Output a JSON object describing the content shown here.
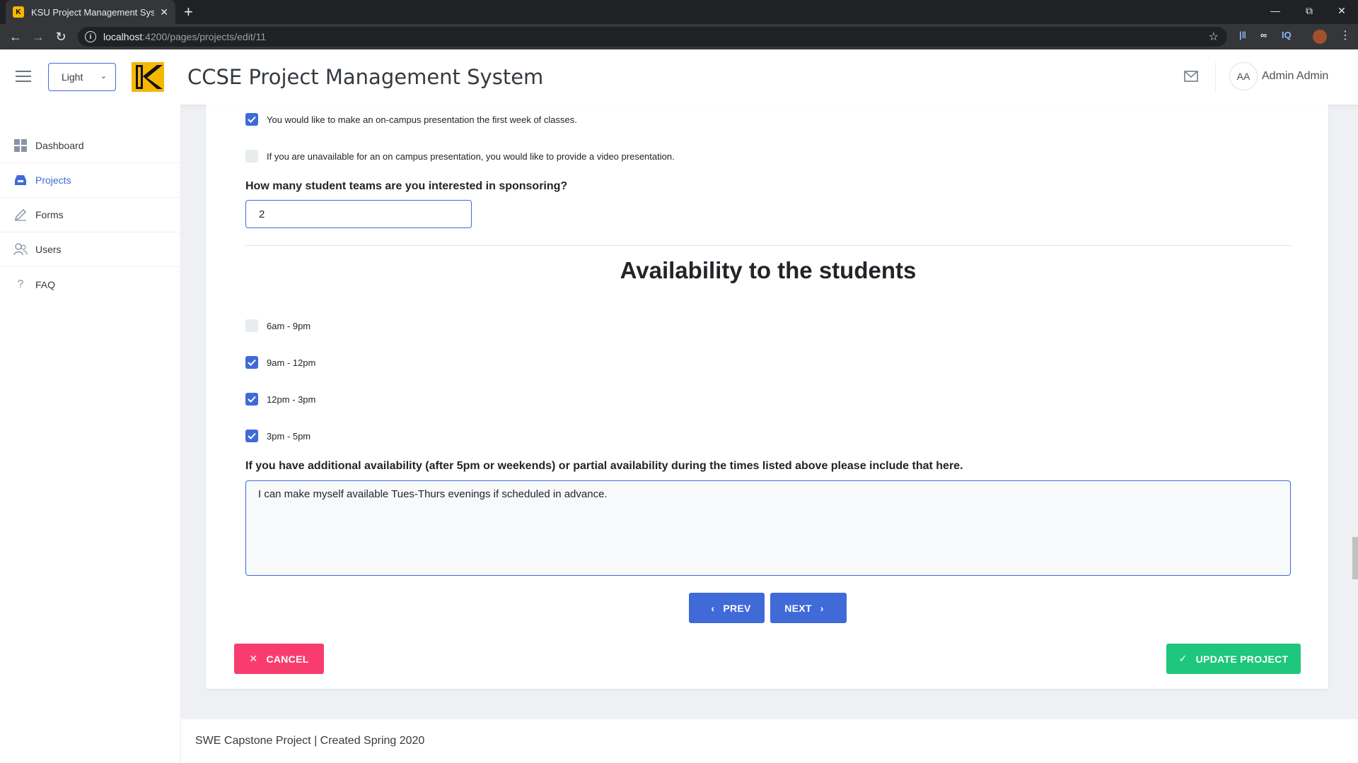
{
  "browser": {
    "tab_title": "KSU Project Management System",
    "url_host": "localhost",
    "url_path": ":4200/pages/projects/edit/11"
  },
  "header": {
    "theme_value": "Light",
    "app_title": "CCSE Project Management System",
    "avatar_initials": "AA",
    "user_name": "Admin Admin"
  },
  "sidebar": {
    "items": [
      {
        "label": "Dashboard",
        "icon": "dashboard-icon"
      },
      {
        "label": "Projects",
        "icon": "inbox-icon"
      },
      {
        "label": "Forms",
        "icon": "pencil-icon"
      },
      {
        "label": "Users",
        "icon": "users-icon"
      },
      {
        "label": "FAQ",
        "icon": "question-icon"
      }
    ]
  },
  "form": {
    "presentation_options": [
      {
        "label": "You would like to make an on-campus presentation the first week of classes.",
        "checked": true
      },
      {
        "label": "If you are unavailable for an on campus presentation, you would like to provide a video presentation.",
        "checked": false
      }
    ],
    "teams_question": "How many student teams are you interested in sponsoring?",
    "teams_value": "2",
    "availability_title": "Availability to the students",
    "availability_options": [
      {
        "label": "6am - 9pm",
        "checked": false
      },
      {
        "label": "9am - 12pm",
        "checked": true
      },
      {
        "label": "12pm - 3pm",
        "checked": true
      },
      {
        "label": "3pm - 5pm",
        "checked": true
      }
    ],
    "additional_question": "If you have additional availability (after 5pm or weekends) or partial availability during the times listed above please include that here.",
    "additional_value": "I can make myself available Tues-Thurs evenings if scheduled in advance.",
    "prev_label": "PREV",
    "next_label": "NEXT",
    "cancel_label": "CANCEL",
    "update_label": "UPDATE PROJECT"
  },
  "footer": {
    "text": "SWE Capstone Project | Created Spring 2020"
  },
  "colors": {
    "primary": "#3f6ad8",
    "danger": "#f83d6e",
    "success": "#1ec77b"
  }
}
